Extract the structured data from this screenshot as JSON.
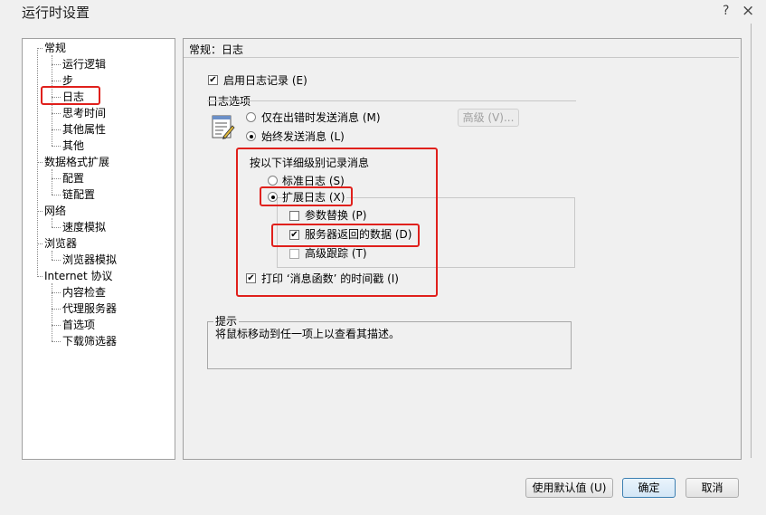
{
  "window": {
    "title": "运行时设置",
    "help_glyph": "?",
    "close_glyph": "×"
  },
  "tree": {
    "items": [
      {
        "label": "常规"
      },
      {
        "label": "运行逻辑"
      },
      {
        "label": "步"
      },
      {
        "label": "日志"
      },
      {
        "label": "思考时间"
      },
      {
        "label": "其他属性"
      },
      {
        "label": "其他"
      },
      {
        "label": "数据格式扩展"
      },
      {
        "label": "配置"
      },
      {
        "label": "链配置"
      },
      {
        "label": "网络"
      },
      {
        "label": "速度模拟"
      },
      {
        "label": "浏览器"
      },
      {
        "label": "浏览器模拟"
      },
      {
        "label": "Internet 协议"
      },
      {
        "label": "内容检查"
      },
      {
        "label": "代理服务器"
      },
      {
        "label": "首选项"
      },
      {
        "label": "下载筛选器"
      }
    ]
  },
  "panel": {
    "header": "常规：日志",
    "enable_logging": {
      "label": "启用日志记录 (E)",
      "checked": true
    },
    "log_options_title": "日志选项",
    "send_on_error": {
      "label": "仅在出错时发送消息 (M)",
      "selected": false
    },
    "advanced_button": "高级 (V)...",
    "always_send": {
      "label": "始终发送消息 (L)",
      "selected": true
    },
    "detail_level_title": "按以下详细级别记录消息",
    "standard_log": {
      "label": "标准日志 (S)",
      "selected": false
    },
    "extended_log": {
      "label": "扩展日志 (X)",
      "selected": true
    },
    "param_substitution": {
      "label": "参数替换 (P)",
      "checked": false
    },
    "server_returned_data": {
      "label": "服务器返回的数据 (D)",
      "checked": true
    },
    "advanced_trace": {
      "label": "高级跟踪 (T)",
      "checked": false
    },
    "print_timestamp": {
      "label": "打印 ‘消息函数’ 的时间戳 (I)",
      "checked": true
    },
    "hint": {
      "title": "提示",
      "text": "将鼠标移动到任一项上以查看其描述。"
    }
  },
  "footer": {
    "use_defaults": "使用默认值 (U)",
    "ok": "确定",
    "cancel": "取消"
  },
  "colors": {
    "highlight": "#e0201c",
    "window_bg": "#f0f0f0"
  }
}
